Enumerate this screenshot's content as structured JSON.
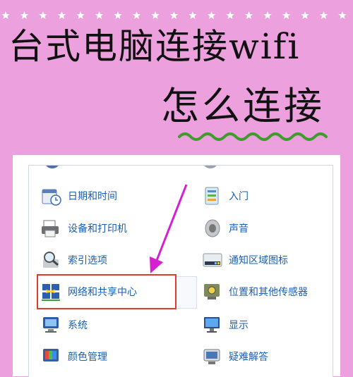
{
  "title": {
    "line1": "台式电脑连接wifi",
    "line2": "怎么连接"
  },
  "control_panel": {
    "left": [
      {
        "label": "日期和时间",
        "icon": "calendar-clock-icon"
      },
      {
        "label": "设备和打印机",
        "icon": "printer-icon"
      },
      {
        "label": "索引选项",
        "icon": "magnifier-icon"
      },
      {
        "label": "网络和共享中心",
        "icon": "network-icon"
      },
      {
        "label": "系统",
        "icon": "computer-icon"
      },
      {
        "label": "颜色管理",
        "icon": "color-management-icon"
      }
    ],
    "right": [
      {
        "label": "入门",
        "icon": "getting-started-icon"
      },
      {
        "label": "声音",
        "icon": "speaker-icon"
      },
      {
        "label": "通知区域图标",
        "icon": "notification-tray-icon"
      },
      {
        "label": "位置和其他传感器",
        "icon": "sensor-icon"
      },
      {
        "label": "显示",
        "icon": "monitor-icon"
      },
      {
        "label": "疑难解答",
        "icon": "troubleshoot-icon"
      }
    ]
  },
  "colors": {
    "background": "#eca0dd",
    "link": "#1a5fb4",
    "highlight": "#e33a2e",
    "arrow": "#d61fd0",
    "wave": "#3d9d2a"
  }
}
